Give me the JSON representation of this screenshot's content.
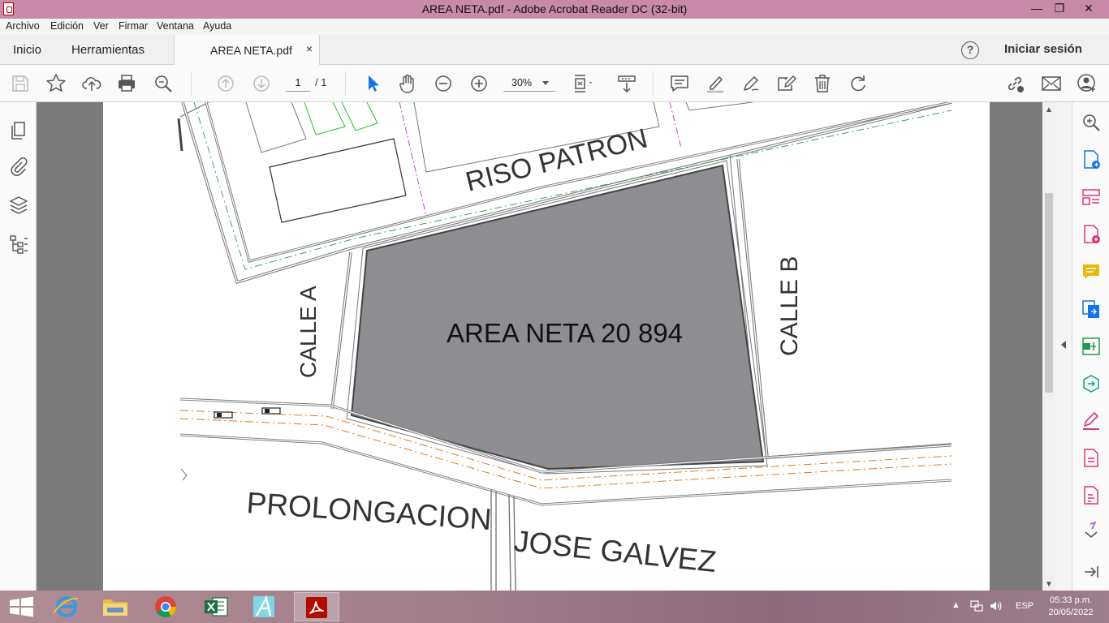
{
  "window": {
    "title": "AREA NETA.pdf - Adobe Acrobat Reader DC (32-bit)",
    "controls": {
      "minimize": "—",
      "maximize": "❐",
      "close": "✕"
    }
  },
  "menubar": {
    "items": [
      "Archivo",
      "Edición",
      "Ver",
      "Firmar",
      "Ventana",
      "Ayuda"
    ]
  },
  "tabs": {
    "home": "Inicio",
    "tools": "Herramientas",
    "document": "AREA NETA.pdf",
    "close": "×",
    "help": "?",
    "signin": "Iniciar sesión"
  },
  "toolbar": {
    "page_current": "1",
    "page_total": "/ 1",
    "zoom": "30%"
  },
  "document": {
    "labels": {
      "riso_patron": "RISO PATRON",
      "calle_a": "CALLE A",
      "calle_b": "CALLE B",
      "area_neta": "AREA NETA 20 894",
      "prolongacion": "PROLONGACION",
      "jose_galvez": "JOSE GALVEZ"
    },
    "area_fill": "#8e8e92"
  },
  "taskbar": {
    "apps": [
      "ie-icon",
      "file-explorer-icon",
      "chrome-icon",
      "excel-icon",
      "autocad-icon",
      "acrobat-icon"
    ],
    "lang": "ESP",
    "time": "05:33 p.m.",
    "date": "20/05/2022"
  },
  "colors": {
    "titlebar": "#c88aa8",
    "accent_blue": "#1473e6",
    "tool_pink": "#d9367a",
    "tool_yellow": "#e8b90d",
    "tool_green": "#1e9a52",
    "tool_teal": "#0aa38c"
  }
}
